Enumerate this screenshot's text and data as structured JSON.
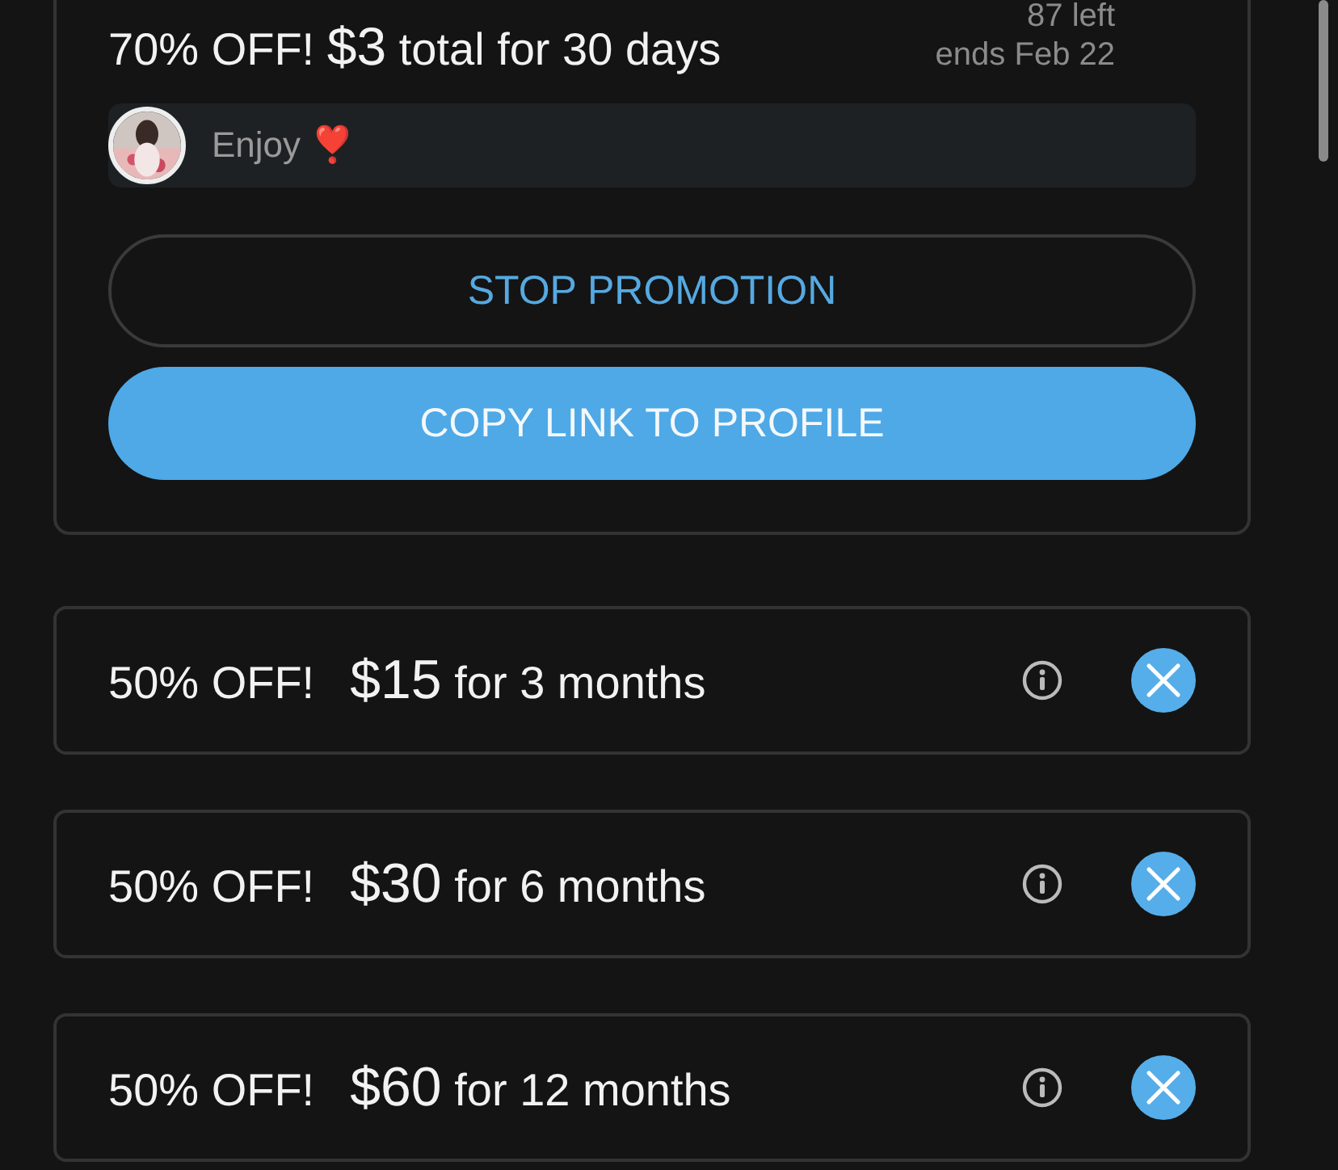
{
  "promotion": {
    "discount": "70% OFF!",
    "price": "$3",
    "terms": "total for 30 days",
    "remaining": "87 left",
    "ends": "ends Feb 22",
    "message": "Enjoy ❣️",
    "buttons": [
      {
        "label": "STOP PROMOTION",
        "kind": "outline"
      },
      {
        "label": "COPY LINK TO PROFILE",
        "kind": "filled"
      }
    ]
  },
  "offers": [
    {
      "discount": "50% OFF!",
      "price": "$15",
      "terms": "for 3 months"
    },
    {
      "discount": "50% OFF!",
      "price": "$30",
      "terms": "for 6 months"
    },
    {
      "discount": "50% OFF!",
      "price": "$60",
      "terms": "for 12 months"
    }
  ]
}
